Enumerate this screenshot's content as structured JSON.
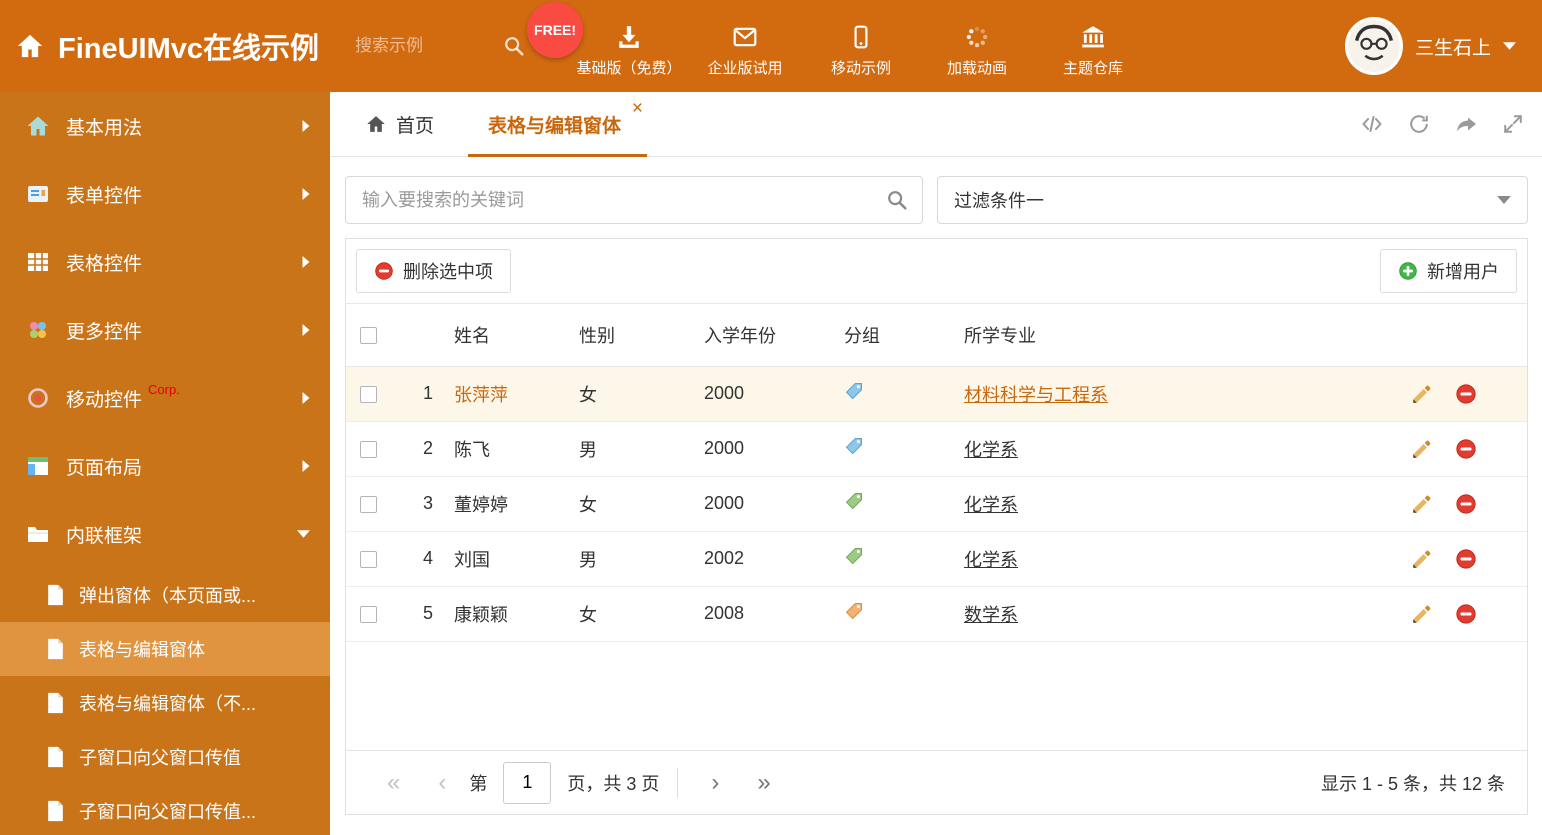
{
  "header": {
    "title": "FineUIMvc在线示例",
    "search_placeholder": "搜索示例",
    "free_badge": "FREE!",
    "user_name": "三生石上",
    "nav": [
      {
        "id": "basic-free",
        "label": "基础版（免费）",
        "icon": "download"
      },
      {
        "id": "enterprise-trial",
        "label": "企业版试用",
        "icon": "mail"
      },
      {
        "id": "mobile-demo",
        "label": "移动示例",
        "icon": "mobile"
      },
      {
        "id": "loading-animation",
        "label": "加载动画",
        "icon": "spinner"
      },
      {
        "id": "theme-store",
        "label": "主题仓库",
        "icon": "bank"
      }
    ]
  },
  "sidebar": {
    "items": [
      {
        "id": "basic-usage",
        "label": "基本用法",
        "icon": "home-colored"
      },
      {
        "id": "form-controls",
        "label": "表单控件",
        "icon": "form"
      },
      {
        "id": "grid-controls",
        "label": "表格控件",
        "icon": "grid"
      },
      {
        "id": "more-controls",
        "label": "更多控件",
        "icon": "dots"
      },
      {
        "id": "mobile-controls",
        "label": "移动控件",
        "icon": "pin",
        "badge": "Corp."
      },
      {
        "id": "page-layout",
        "label": "页面布局",
        "icon": "layout"
      },
      {
        "id": "inline-frame",
        "label": "内联框架",
        "icon": "folder",
        "expanded": true,
        "children": [
          {
            "id": "popup-window",
            "label": "弹出窗体（本页面或..."
          },
          {
            "id": "grid-edit-window",
            "label": "表格与编辑窗体",
            "selected": true
          },
          {
            "id": "grid-edit-window-no",
            "label": "表格与编辑窗体（不..."
          },
          {
            "id": "child-to-parent",
            "label": "子窗口向父窗口传值"
          },
          {
            "id": "child-to-parent-2",
            "label": "子窗口向父窗口传值..."
          }
        ]
      }
    ]
  },
  "tabs": [
    {
      "label": "首页"
    },
    {
      "label": "表格与编辑窗体",
      "active": true
    }
  ],
  "icons": {
    "close_tab": "×"
  },
  "filter": {
    "search_placeholder": "输入要搜索的关键词",
    "dropdown_value": "过滤条件一"
  },
  "toolbar": {
    "delete_label": "删除选中项",
    "add_label": "新增用户"
  },
  "table": {
    "columns": [
      "姓名",
      "性别",
      "入学年份",
      "分组",
      "所学专业"
    ],
    "rows": [
      {
        "index": 1,
        "name": "张萍萍",
        "gender": "女",
        "year": "2000",
        "tag_color": "blue",
        "major": "材料科学与工程系",
        "highlight": true
      },
      {
        "index": 2,
        "name": "陈飞",
        "gender": "男",
        "year": "2000",
        "tag_color": "blue",
        "major": "化学系"
      },
      {
        "index": 3,
        "name": "董婷婷",
        "gender": "女",
        "year": "2000",
        "tag_color": "green",
        "major": "化学系"
      },
      {
        "index": 4,
        "name": "刘国",
        "gender": "男",
        "year": "2002",
        "tag_color": "green",
        "major": "化学系"
      },
      {
        "index": 5,
        "name": "康颖颖",
        "gender": "女",
        "year": "2008",
        "tag_color": "orange",
        "major": "数学系"
      }
    ]
  },
  "pagination": {
    "first": "«",
    "prev": "‹",
    "next": "›",
    "last": "»",
    "page_prefix": "第",
    "current_page": "1",
    "page_suffix": "页，共 3 页",
    "summary": "显示 1 - 5 条，共 12 条"
  },
  "colors": {
    "accent": "#c8680e",
    "header_bg": "#d26a10",
    "sidebar_bg": "#ca7419",
    "sidebar_selected": "#e09440",
    "row_highlight": "#fdf7ea",
    "delete_red": "#e23b30",
    "add_green": "#43b649",
    "tag_blue": "#8ec7ec",
    "tag_green": "#9ccb83",
    "tag_orange": "#f3b273"
  }
}
